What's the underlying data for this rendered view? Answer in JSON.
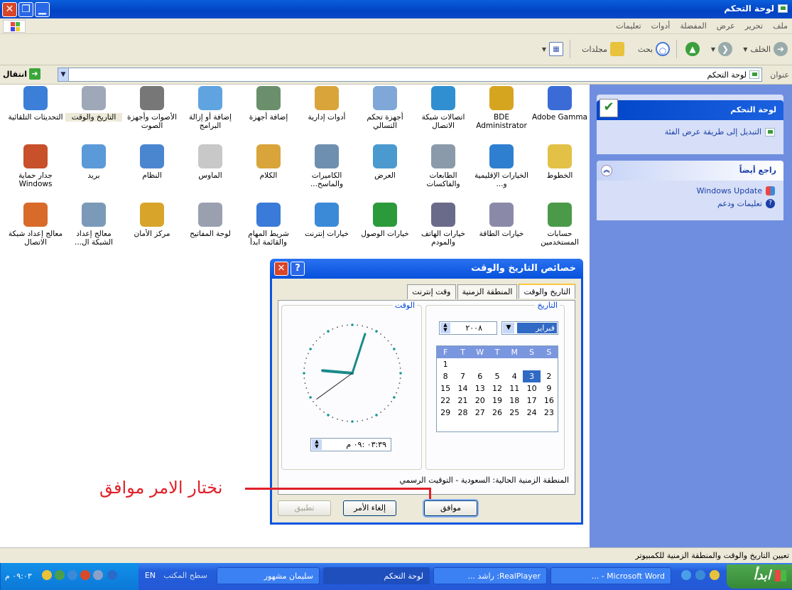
{
  "window": {
    "title": "لوحة التحكم"
  },
  "menu": [
    "ملف",
    "تحرير",
    "عرض",
    "المفضلة",
    "أدوات",
    "تعليمات"
  ],
  "toolbar": {
    "back": "الخلف",
    "search": "بحث",
    "folders": "مجلدات"
  },
  "address": {
    "label": "عنوان",
    "value": "لوحة التحكم",
    "go": "انتقال"
  },
  "taskpane": {
    "panel1": {
      "title": "لوحة التحكم",
      "link": "التبديل إلى طريقة عرض الفئة"
    },
    "panel2": {
      "title": "راجع أيضاً",
      "links": [
        "Windows Update",
        "تعليمات ودعم"
      ]
    }
  },
  "icons": [
    {
      "label": "Adobe Gamma",
      "color": "#3a6bd6"
    },
    {
      "label": "BDE Administrator",
      "color": "#d6a520"
    },
    {
      "label": "اتصالات شبكة الاتصال",
      "color": "#2f8fd0"
    },
    {
      "label": "أجهزة تحكم التسالي",
      "color": "#7fa7d8"
    },
    {
      "label": "أدوات إدارية",
      "color": "#d9a43a"
    },
    {
      "label": "إضافة أجهزة",
      "color": "#6a8f6a"
    },
    {
      "label": "إضافة أو إزالة البرامج",
      "color": "#5fa3e0"
    },
    {
      "label": "الأصوات وأجهزة الصوت",
      "color": "#777777"
    },
    {
      "label": "التاريخ والوقت",
      "color": "#9fa8b8"
    },
    {
      "label": "التحديثات التلقائية",
      "color": "#3b7fd8"
    },
    {
      "label": "الخطوط",
      "color": "#e3c147"
    },
    {
      "label": "الخيارات الإقليمية و...",
      "color": "#2f7fd0"
    },
    {
      "label": "الطابعات والفاكسات",
      "color": "#8a9aaa"
    },
    {
      "label": "العرض",
      "color": "#4a9ad0"
    },
    {
      "label": "الكاميرات والماسح...",
      "color": "#6f8fb0"
    },
    {
      "label": "الكلام",
      "color": "#d9a43a"
    },
    {
      "label": "الماوس",
      "color": "#c8c8c8"
    },
    {
      "label": "النظام",
      "color": "#4a86d0"
    },
    {
      "label": "بريد",
      "color": "#5a9ad8"
    },
    {
      "label": "جدار حماية Windows",
      "color": "#c8502a"
    },
    {
      "label": "حسابات المستخدمين",
      "color": "#4a9a4a"
    },
    {
      "label": "خيارات الطاقة",
      "color": "#8a8aa8"
    },
    {
      "label": "خيارات الهاتف والمودم",
      "color": "#6a6a8a"
    },
    {
      "label": "خيارات الوصول",
      "color": "#2a9a3a"
    },
    {
      "label": "خيارات إنترنت",
      "color": "#3a8ad8"
    },
    {
      "label": "شريط المهام والقائمة ابدأ",
      "color": "#3a7ad8"
    },
    {
      "label": "لوحة المفاتيح",
      "color": "#9aa0b0"
    },
    {
      "label": "مركز الأمان",
      "color": "#d8a52a"
    },
    {
      "label": "معالج إعداد الشبكة ال...",
      "color": "#7a9ab8"
    },
    {
      "label": "معالج إعداد شبكة الاتصال",
      "color": "#d86a2a"
    }
  ],
  "dialog": {
    "title": "خصائص التاريخ والوقت",
    "tabs": [
      "التاريخ والوقت",
      "المنطقة الزمنية",
      "وقت إنترنت"
    ],
    "date_group": "التاريخ",
    "time_group": "الوقت",
    "month": "فبراير",
    "year": "٢٠٠٨",
    "weekdays": [
      "S",
      "S",
      "M",
      "T",
      "W",
      "T",
      "F"
    ],
    "calendar_rows": [
      [
        "",
        "",
        "",
        "",
        "",
        "",
        "1"
      ],
      [
        "2",
        "3",
        "4",
        "5",
        "6",
        "7",
        "8"
      ],
      [
        "9",
        "10",
        "11",
        "12",
        "13",
        "14",
        "15"
      ],
      [
        "16",
        "17",
        "18",
        "19",
        "20",
        "21",
        "22"
      ],
      [
        "23",
        "24",
        "25",
        "26",
        "27",
        "28",
        "29"
      ]
    ],
    "selected_day": "3",
    "time": "٠٣:٣٩ :٠٩ م",
    "timezone": "المنطقة الزمنية الحالية: السعودية - التوقيت الرسمي",
    "ok": "موافق",
    "cancel": "إلغاء الأمر",
    "apply": "تطبيق"
  },
  "annotation": "نختار الامر موافق",
  "status": "تعيين التاريخ والوقت والمنطقة الزمنية للكمبيوتر",
  "taskbar": {
    "start": "ابدأ",
    "tasks": [
      "Microsoft Word - ...",
      "RealPlayer: راشد ...",
      "لوحة التحكم",
      "سليمان مشهور"
    ],
    "desktop": "سطح المكتب",
    "lang": "EN",
    "clock": "٠٩:٠٣ م"
  }
}
